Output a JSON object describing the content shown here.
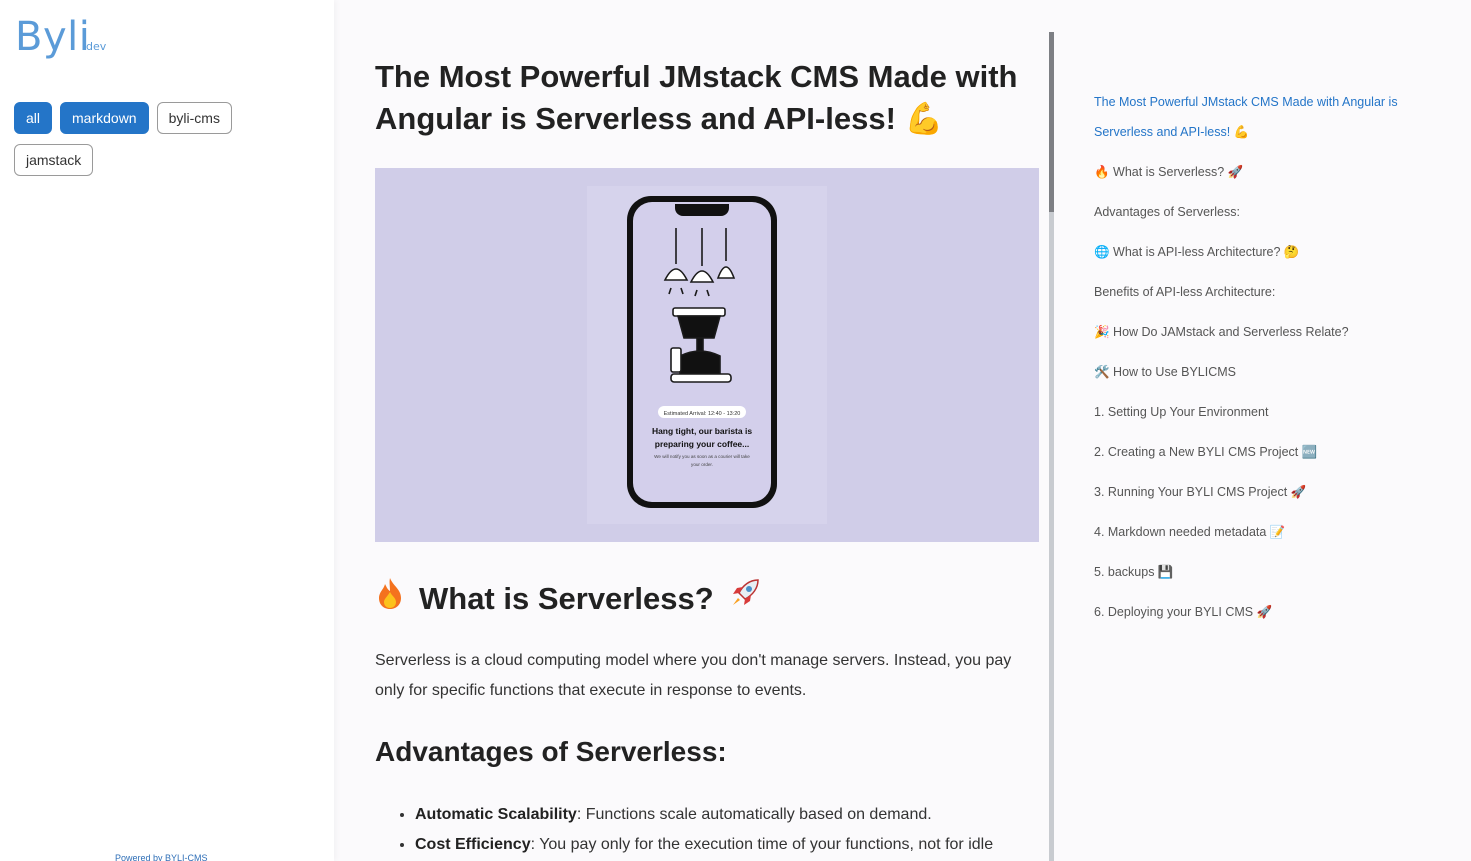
{
  "brand": {
    "name": "Byli",
    "sub": "dev",
    "color": "#5b9bd8"
  },
  "tags": [
    {
      "label": "all",
      "active": true
    },
    {
      "label": "markdown",
      "active": true
    },
    {
      "label": "byli-cms",
      "active": false
    },
    {
      "label": "jamstack",
      "active": false
    }
  ],
  "footer": {
    "powered": "Powered by BYLI-CMS"
  },
  "article": {
    "title": "The Most Powerful JMstack CMS Made with Angular is Serverless and API-less! 💪",
    "hero_image": {
      "badge": "Estimated Arrival: 12:40 - 13:20",
      "heading_line1": "Hang tight, our barista is",
      "heading_line2": "preparing your coffee...",
      "sub_line1": "We will notify you as soon as a courier will take",
      "sub_line2": "your order."
    },
    "section1_title": "What is Serverless?",
    "section1_icon_left": "fire-icon",
    "section1_icon_right": "rocket-icon",
    "section1_para": "Serverless is a cloud computing model where you don't manage servers. Instead, you pay only for specific functions that execute in response to events.",
    "section2_title": "Advantages of Serverless:",
    "bullets": [
      {
        "term": "Automatic Scalability",
        "text": ": Functions scale automatically based on demand."
      },
      {
        "term": "Cost Efficiency",
        "text": ": You pay only for the execution time of your functions, not for idle"
      }
    ]
  },
  "toc": [
    "The Most Powerful JMstack CMS Made with Angular is Serverless and API-less! 💪",
    "🔥 What is Serverless? 🚀",
    "Advantages of Serverless:",
    "🌐 What is API-less Architecture? 🤔",
    "Benefits of API-less Architecture:",
    "🎉 How Do JAMstack and Serverless Relate?",
    "🛠️ How to Use BYLICMS",
    "1. Setting Up Your Environment",
    "2. Creating a New BYLI CMS Project 🆕",
    "3. Running Your BYLI CMS Project 🚀",
    "4. Markdown needed metadata 📝",
    "5. backups 💾",
    "6. Deploying your BYLI CMS 🚀"
  ],
  "colors": {
    "accent": "#2475c8",
    "hero_bg": "#d0cde8"
  }
}
